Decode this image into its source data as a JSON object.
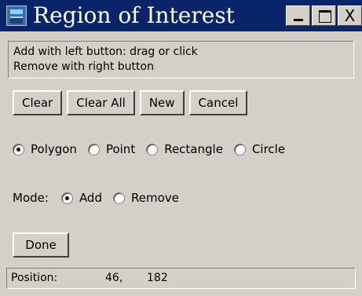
{
  "window": {
    "title": "Region of Interest",
    "icon": "roi-window-icon",
    "controls": {
      "minimize_icon": "minimize-icon",
      "maximize_icon": "maximize-icon",
      "close_label": "X"
    }
  },
  "instructions": {
    "line1": "Add with left button: drag or click",
    "line2": "Remove with right button"
  },
  "buttons": {
    "clear": "Clear",
    "clear_all": "Clear All",
    "new": "New",
    "cancel": "Cancel",
    "done": "Done"
  },
  "shape_options": [
    {
      "label": "Polygon",
      "selected": true
    },
    {
      "label": "Point",
      "selected": false
    },
    {
      "label": "Rectangle",
      "selected": false
    },
    {
      "label": "Circle",
      "selected": false
    }
  ],
  "mode": {
    "label": "Mode:",
    "options": [
      {
        "label": "Add",
        "selected": true
      },
      {
        "label": "Remove",
        "selected": false
      }
    ]
  },
  "status": {
    "label": "Position:",
    "x": "46,",
    "y": "182"
  },
  "colors": {
    "titlebar": "#0a246a",
    "face": "#d4d0c8"
  }
}
